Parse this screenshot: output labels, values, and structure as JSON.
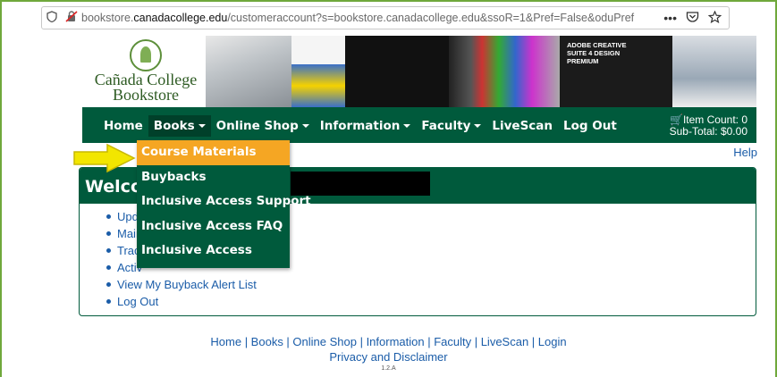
{
  "browser": {
    "url_prefix": "bookstore.",
    "url_domain": "canadacollege.edu",
    "url_rest": "/customeraccount?s=bookstore.canadacollege.edu&ssoR=1&Pref=False&oduPref",
    "more_label": "•••"
  },
  "logo": {
    "line1": "Cañada College",
    "line2": "Bookstore"
  },
  "banner": {
    "adobe_text": "ADOBE CREATIVE SUITE 4 DESIGN PREMIUM"
  },
  "nav": {
    "items": [
      "Home",
      "Books",
      "Online Shop",
      "Information",
      "Faculty",
      "LiveScan",
      "Log Out"
    ],
    "cart_count": "Item Count: 0",
    "cart_subtotal": "Sub-Total: $0.00"
  },
  "help_label": "Help",
  "welcome": {
    "title": "Welcome",
    "links": [
      "Update",
      "Main",
      "Track",
      "Activ",
      "View My Buyback Alert List",
      "Log Out"
    ]
  },
  "dropdown": {
    "items": [
      "Course Materials",
      "Buybacks",
      "Inclusive Access Support",
      "Inclusive Access FAQ",
      "Inclusive Access"
    ],
    "highlighted": "Course Materials"
  },
  "footer": {
    "links_line": "Home | Books | Online Shop | Information | Faculty | LiveScan | Login",
    "privacy": "Privacy and Disclaimer",
    "version": "1.2.A"
  },
  "colors": {
    "nav_green": "#005a3c",
    "highlight": "#f5a623",
    "link_blue": "#1a5ca8",
    "arrow_yellow": "#f2e600"
  }
}
